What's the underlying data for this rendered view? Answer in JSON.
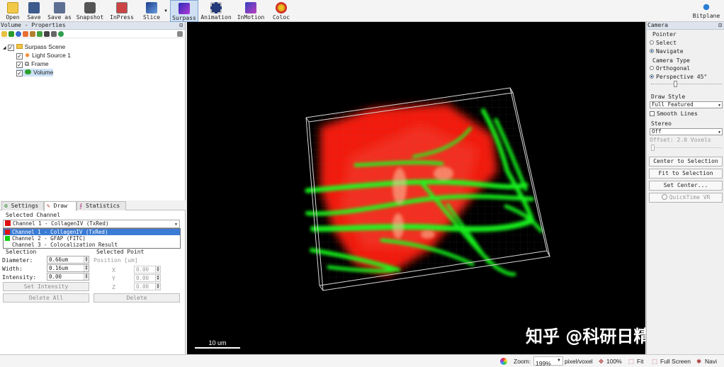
{
  "toolbar": {
    "items": [
      {
        "label": "Open"
      },
      {
        "label": "Save"
      },
      {
        "label": "Save as"
      },
      {
        "label": "Snapshot"
      },
      {
        "label": "InPress"
      },
      {
        "label": "Slice"
      },
      {
        "label": "Surpass"
      },
      {
        "label": "Animation"
      },
      {
        "label": "InMotion"
      },
      {
        "label": "Coloc"
      }
    ],
    "brand": "Bitplane"
  },
  "left_panel": {
    "title": "Volume - Properties",
    "tree": [
      {
        "label": "Surpass Scene",
        "checked": true
      },
      {
        "label": "Light Source 1",
        "checked": true
      },
      {
        "label": "Frame",
        "checked": true
      },
      {
        "label": "Volume",
        "checked": true
      }
    ],
    "tabs": [
      "Settings",
      "Draw",
      "Statistics"
    ],
    "selected_channel_label": "Selected Channel",
    "channel_select_value": "Channel 1 - CollagenIV (TxRed)",
    "channel_options": [
      "Channel 1 - CollagenIV (TxRed)",
      "Channel 2 - GFAP (FITC)",
      "Channel 3 - Colocalization Result"
    ],
    "selection": {
      "title": "Selection",
      "diameter_label": "Diameter:",
      "diameter_value": "0.66um",
      "width_label": "Width:",
      "width_value": "0.16um",
      "intensity_label": "Intensity:",
      "intensity_value": "0.00",
      "set_intensity": "Set Intensity",
      "delete_all": "Delete All"
    },
    "selected_point": {
      "title": "Selected Point",
      "position_label": "Position [um]",
      "x_label": "X",
      "x_value": "0.00",
      "y_label": "Y",
      "y_value": "0.00",
      "z_label": "Z",
      "z_value": "0.00",
      "delete": "Delete"
    }
  },
  "viewer": {
    "scalebar_label": "10 um",
    "watermark": "知乎 @科研日精进"
  },
  "camera_panel": {
    "title": "Camera",
    "pointer_label": "Pointer",
    "pointer_options": [
      {
        "label": "Select",
        "selected": false
      },
      {
        "label": "Navigate",
        "selected": true
      }
    ],
    "camera_type_label": "Camera Type",
    "camera_options": [
      {
        "label": "Orthogonal",
        "selected": false
      },
      {
        "label": "Perspective 45°",
        "selected": true
      }
    ],
    "draw_style_label": "Draw Style",
    "draw_style_value": "Full Featured",
    "smooth_lines_label": "Smooth Lines",
    "stereo_label": "Stereo",
    "stereo_value": "Off",
    "offset_label": "Offset: 2.0 Voxels",
    "buttons": [
      "Center to Selection",
      "Fit to Selection",
      "Set Center..."
    ],
    "quicktime_label": "QuickTime VR"
  },
  "status_bar": {
    "zoom_label": "Zoom:",
    "zoom_value": "199%",
    "unit": "pixel/voxel",
    "zoom100": "100%",
    "fit": "Fit",
    "fullscreen": "Full Screen",
    "navi": "Navi"
  },
  "colors": {
    "red_channel": "#ff1a10",
    "green_channel": "#18ff1a",
    "selection_highlight": "#3a7bd5"
  }
}
